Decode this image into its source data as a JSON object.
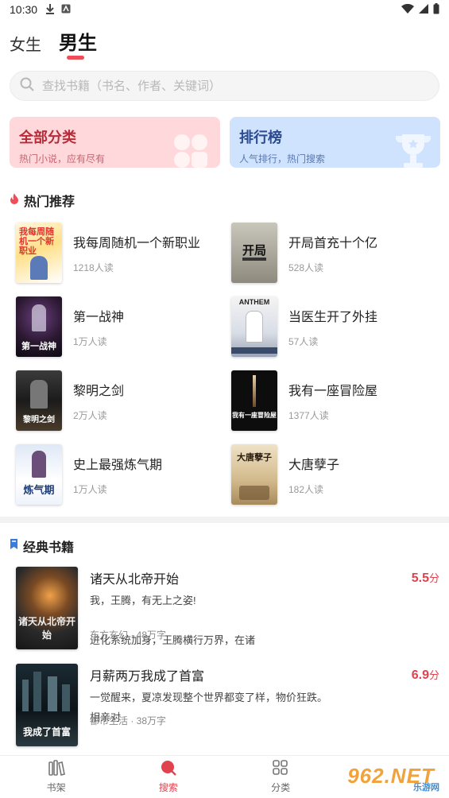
{
  "status_bar": {
    "time": "10:30"
  },
  "tabs": [
    {
      "label": "女生",
      "active": false
    },
    {
      "label": "男生",
      "active": true
    }
  ],
  "search": {
    "placeholder": "查找书籍（书名、作者、关键词）"
  },
  "categories": [
    {
      "title": "全部分类",
      "subtitle": "热门小说，应有尽有",
      "color": "#ffd8dc"
    },
    {
      "title": "排行榜",
      "subtitle": "人气排行，热门搜索",
      "color": "#cfe3ff"
    }
  ],
  "hot": {
    "title": "热门推荐",
    "items": [
      {
        "title": "我每周随机一个新职业",
        "reads": "1218人读",
        "cover_text": "我每周随机一个新职业"
      },
      {
        "title": "开局首充十个亿",
        "reads": "528人读",
        "cover_text": "开局"
      },
      {
        "title": "第一战神",
        "reads": "1万人读",
        "cover_text": "第一战神"
      },
      {
        "title": "当医生开了外挂",
        "reads": "57人读",
        "cover_text": "ANTHEM"
      },
      {
        "title": "黎明之剑",
        "reads": "2万人读",
        "cover_text": "黎明之剑"
      },
      {
        "title": "我有一座冒险屋",
        "reads": "1377人读",
        "cover_text": "我有一座冒险屋"
      },
      {
        "title": "史上最强炼气期",
        "reads": "1万人读",
        "cover_text": "炼气期"
      },
      {
        "title": "大唐孽子",
        "reads": "182人读",
        "cover_text": "大唐孽子"
      }
    ]
  },
  "classic": {
    "title": "经典书籍",
    "items": [
      {
        "title": "诸天从北帝开始",
        "score": "5.5",
        "score_unit": "分",
        "desc": "我，王腾，有无上之姿!\n\n    进化系统加身，王腾横行万界，在诸",
        "meta": "东方玄幻 · 48万字",
        "cover_text": "诸天从北帝开始"
      },
      {
        "title": "月薪两万我成了首富",
        "score": "6.9",
        "score_unit": "分",
        "desc": "一觉醒来，夏凉发现整个世界都变了样，物价狂跌。\n    相亲对",
        "meta": "都市生活 · 38万字",
        "cover_text": "我成了首富"
      }
    ]
  },
  "bottom_nav": [
    {
      "label": "书架",
      "icon": "bookshelf-icon",
      "active": false
    },
    {
      "label": "搜索",
      "icon": "search-icon",
      "active": true
    },
    {
      "label": "分类",
      "icon": "grid-icon",
      "active": false
    }
  ],
  "watermark": {
    "text": "962.NET",
    "sub": "乐游网"
  },
  "colors": {
    "accent": "#e0424e",
    "pink_card": "#ffd8dc",
    "blue_card": "#cfe3ff"
  }
}
